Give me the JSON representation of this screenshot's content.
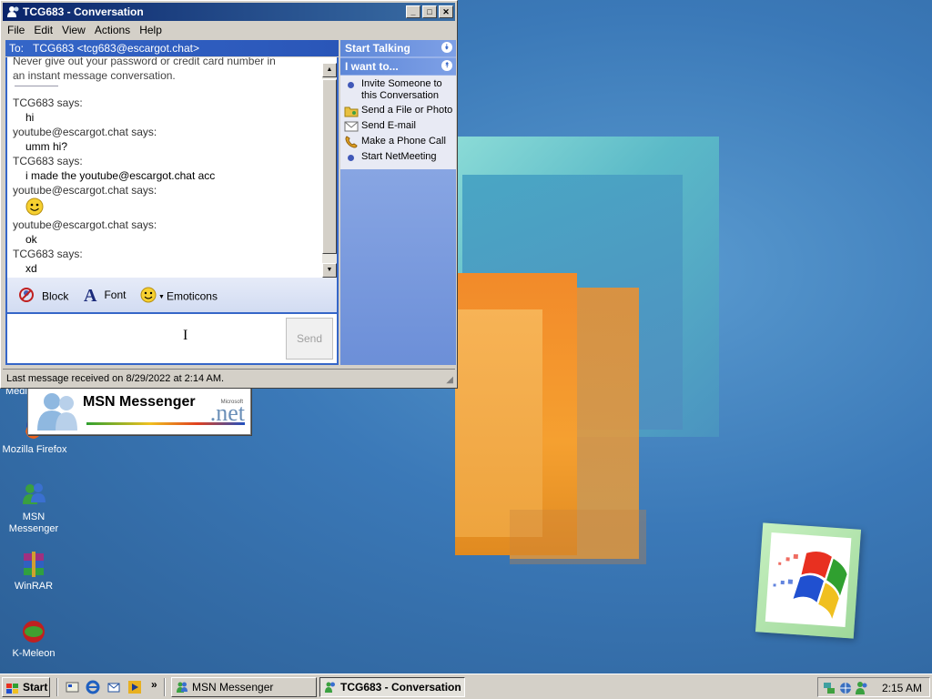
{
  "window": {
    "title": "TCG683 - Conversation",
    "menu": [
      "File",
      "Edit",
      "View",
      "Actions",
      "Help"
    ],
    "to_label": "To:",
    "to_value": "TCG683 <tcg683@escargot.chat>",
    "status": "Last message received on 8/29/2022 at 2:14 AM."
  },
  "messages": {
    "warning_line1": "Never give out your password or credit card number in",
    "warning_line2": "an instant message conversation.",
    "lines": [
      {
        "kind": "sender",
        "text": "TCG683 says:"
      },
      {
        "kind": "body",
        "text": "hi"
      },
      {
        "kind": "sender",
        "text": "youtube@escargot.chat says:"
      },
      {
        "kind": "body",
        "text": "umm hi?"
      },
      {
        "kind": "sender",
        "text": "TCG683 says:"
      },
      {
        "kind": "body",
        "text": "i made the youtube@escargot.chat acc"
      },
      {
        "kind": "sender",
        "text": "youtube@escargot.chat says:"
      },
      {
        "kind": "emoticon",
        "text": ""
      },
      {
        "kind": "sender",
        "text": "youtube@escargot.chat says:"
      },
      {
        "kind": "body",
        "text": "ok"
      },
      {
        "kind": "sender",
        "text": "TCG683 says:"
      },
      {
        "kind": "body",
        "text": "xd"
      }
    ]
  },
  "toolbar": {
    "block_label": "Block",
    "font_label": "Font",
    "emoticons_label": "Emoticons"
  },
  "compose": {
    "send_label": "Send"
  },
  "side": {
    "start_talking": "Start Talking",
    "i_want_to": "I want to...",
    "items": [
      {
        "label": "Invite Someone to this Conversation",
        "icon": "invite-icon"
      },
      {
        "label": "Send a File or Photo",
        "icon": "send-file-icon"
      },
      {
        "label": "Send E-mail",
        "icon": "email-icon"
      },
      {
        "label": "Make a Phone Call",
        "icon": "phone-icon"
      },
      {
        "label": "Start NetMeeting",
        "icon": "netmeeting-icon"
      }
    ]
  },
  "desktop": {
    "icons": [
      "Medi",
      "Mozilla Firefox",
      "MSN Messenger",
      "WinRAR",
      "K-Meleon"
    ],
    "splash": {
      "title": "MSN Messenger",
      "net": ".net",
      "microsoft": "Microsoft"
    }
  },
  "taskbar": {
    "start": "Start",
    "tasks": [
      "MSN Messenger",
      "TCG683 - Conversation"
    ],
    "more": "»",
    "clock": "2:15 AM"
  },
  "colors": {
    "title_bar": "#0a246a",
    "accent_blue": "#3566c8",
    "desktop": "#3a6ea5"
  }
}
